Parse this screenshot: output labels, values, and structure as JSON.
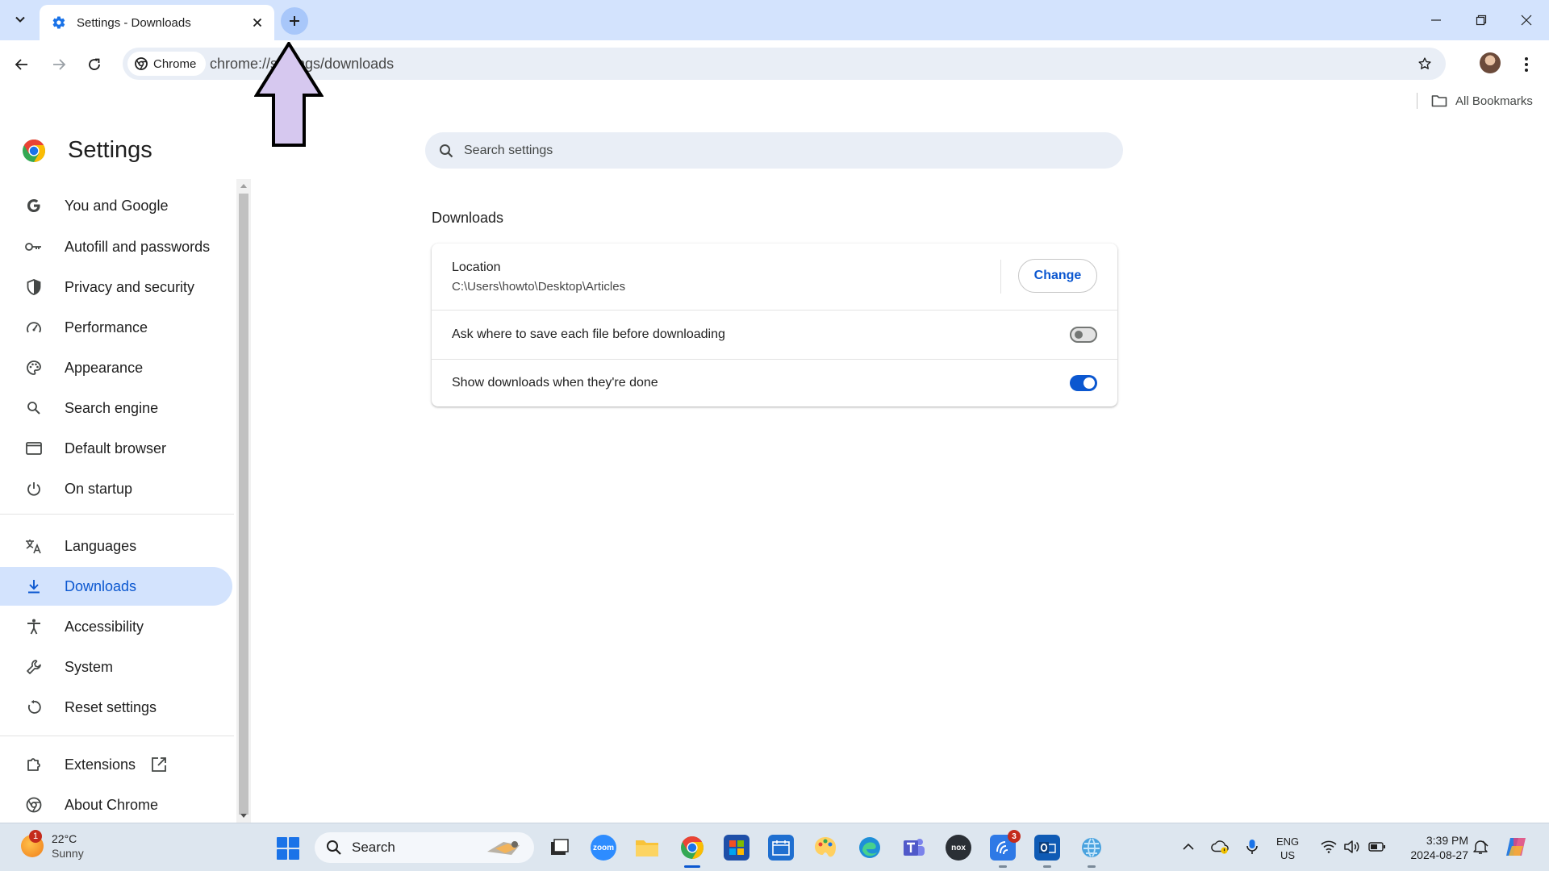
{
  "browser": {
    "tab": {
      "title": "Settings - Downloads",
      "favicon": "settings-gear-icon"
    },
    "address": {
      "chip_label": "Chrome",
      "url": "chrome://settings/downloads"
    },
    "bookmarks": {
      "all_bookmarks_label": "All Bookmarks"
    }
  },
  "settings": {
    "title": "Settings",
    "search_placeholder": "Search settings",
    "nav": {
      "you_and_google": "You and Google",
      "autofill": "Autofill and passwords",
      "privacy": "Privacy and security",
      "performance": "Performance",
      "appearance": "Appearance",
      "search_engine": "Search engine",
      "default_browser": "Default browser",
      "on_startup": "On startup",
      "languages": "Languages",
      "downloads": "Downloads",
      "accessibility": "Accessibility",
      "system": "System",
      "reset": "Reset settings",
      "extensions": "Extensions",
      "about": "About Chrome"
    },
    "active_nav": "downloads",
    "section_title": "Downloads",
    "location": {
      "label": "Location",
      "path": "C:\\Users\\howto\\Desktop\\Articles",
      "button": "Change"
    },
    "ask_where": {
      "label": "Ask where to save each file before downloading",
      "enabled": false
    },
    "show_downloads": {
      "label": "Show downloads when they're done",
      "enabled": true
    }
  },
  "taskbar": {
    "weather": {
      "temp": "22°C",
      "condition": "Sunny",
      "badge": "1"
    },
    "search_label": "Search",
    "apps": [
      "task-view",
      "zoom",
      "file-explorer",
      "chrome",
      "microsoft-store",
      "outlook-calendar",
      "paint",
      "edge",
      "teams",
      "nox",
      "copilot-app",
      "outlook",
      "remote-desktop"
    ],
    "zoom_label": "zoom",
    "nox_label": "nox",
    "copilot_badge": "3",
    "language": {
      "lang": "ENG",
      "region": "US"
    },
    "clock": {
      "time": "3:39 PM",
      "date": "2024-08-27"
    }
  },
  "colors": {
    "accent": "#0b57d0",
    "tabstrip": "#d3e3fd",
    "active_nav_bg": "#d3e3fd",
    "annotation_arrow_fill": "#d6c8ef"
  }
}
